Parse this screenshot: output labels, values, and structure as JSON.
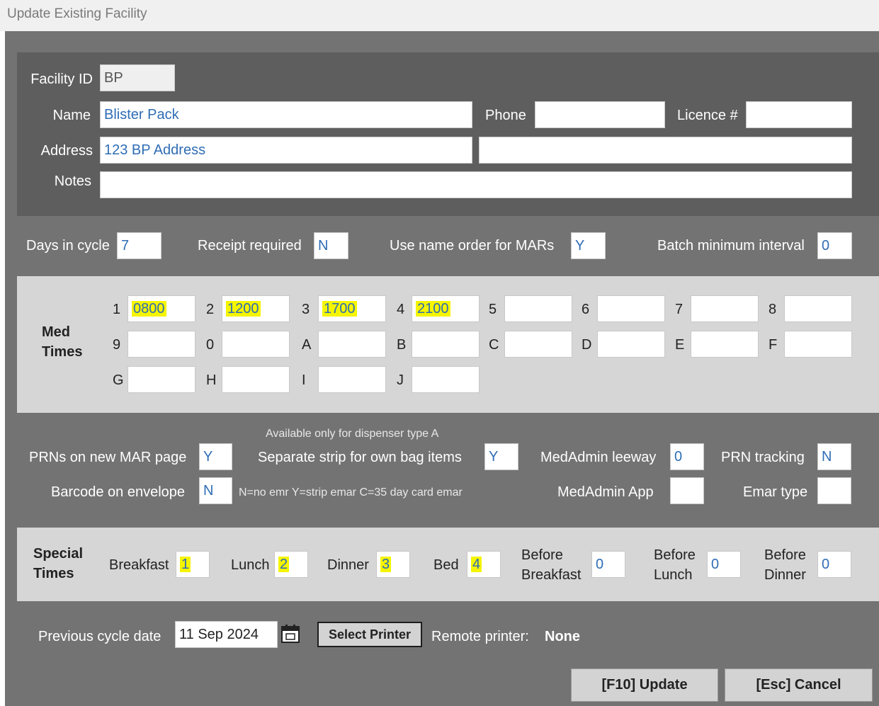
{
  "window": {
    "title": "Update Existing Facility"
  },
  "facility": {
    "id_label": "Facility ID",
    "id_value": "BP",
    "name_label": "Name",
    "name_value": "Blister Pack",
    "phone_label": "Phone",
    "phone_value": "",
    "licence_label": "Licence #",
    "licence_value": "",
    "address_label": "Address",
    "address_value": "123 BP Address",
    "address2_value": "",
    "notes_label": "Notes",
    "notes_value": ""
  },
  "cycle": {
    "days_label": "Days in cycle",
    "days_value": "7",
    "receipt_label": "Receipt required",
    "receipt_value": "N",
    "name_order_label": "Use name order for MARs",
    "name_order_value": "Y",
    "batch_label": "Batch minimum interval",
    "batch_value": "0"
  },
  "med_times": {
    "heading_line1": "Med",
    "heading_line2": "Times",
    "slots": [
      {
        "key": "1",
        "value": "0800",
        "highlight": true
      },
      {
        "key": "2",
        "value": "1200",
        "highlight": true
      },
      {
        "key": "3",
        "value": "1700",
        "highlight": true
      },
      {
        "key": "4",
        "value": "2100",
        "highlight": true
      },
      {
        "key": "5",
        "value": ""
      },
      {
        "key": "6",
        "value": ""
      },
      {
        "key": "7",
        "value": ""
      },
      {
        "key": "8",
        "value": ""
      },
      {
        "key": "9",
        "value": ""
      },
      {
        "key": "0",
        "value": ""
      },
      {
        "key": "A",
        "value": ""
      },
      {
        "key": "B",
        "value": ""
      },
      {
        "key": "C",
        "value": ""
      },
      {
        "key": "D",
        "value": ""
      },
      {
        "key": "E",
        "value": ""
      },
      {
        "key": "F",
        "value": ""
      },
      {
        "key": "G",
        "value": ""
      },
      {
        "key": "H",
        "value": ""
      },
      {
        "key": "I",
        "value": ""
      },
      {
        "key": "J",
        "value": ""
      }
    ]
  },
  "options": {
    "available_note": "Available only for dispenser type A",
    "prns_label": "PRNs on new MAR page",
    "prns_value": "Y",
    "strip_label": "Separate strip for own bag items",
    "strip_value": "Y",
    "leeway_label": "MedAdmin leeway",
    "leeway_value": "0",
    "prn_tracking_label": "PRN tracking",
    "prn_tracking_value": "N",
    "barcode_label": "Barcode on envelope",
    "barcode_value": "N",
    "emar_hint": "N=no emr  Y=strip emar  C=35 day card emar",
    "medadmin_app_label": "MedAdmin App",
    "medadmin_app_value": "",
    "emar_type_label": "Emar type",
    "emar_type_value": ""
  },
  "special_times": {
    "heading_line1": "Special",
    "heading_line2": "Times",
    "breakfast_label": "Breakfast",
    "breakfast_value": "1",
    "lunch_label": "Lunch",
    "lunch_value": "2",
    "dinner_label": "Dinner",
    "dinner_value": "3",
    "bed_label": "Bed",
    "bed_value": "4",
    "before_label": "Before",
    "before_breakfast_label": "Breakfast",
    "before_breakfast_value": "0",
    "before_lunch_label": "Lunch",
    "before_lunch_value": "0",
    "before_dinner_label": "Dinner",
    "before_dinner_value": "0"
  },
  "footer": {
    "prev_cycle_label": "Previous cycle date",
    "prev_cycle_value": "11 Sep 2024",
    "select_printer": "Select Printer",
    "remote_printer_label": "Remote printer:",
    "remote_printer_value": "None",
    "update_button": "[F10] Update",
    "cancel_button": "[Esc] Cancel"
  }
}
